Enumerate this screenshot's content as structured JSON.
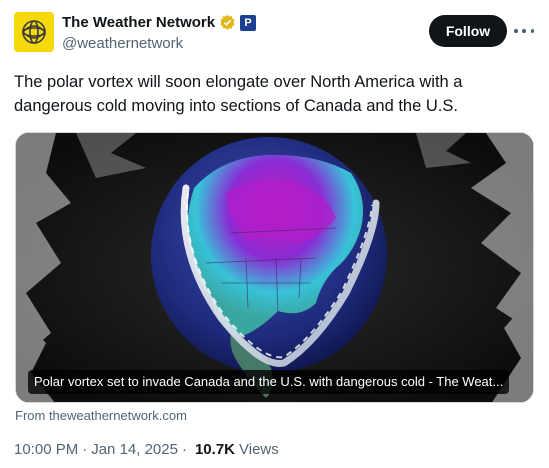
{
  "author": {
    "display_name": "The Weather Network",
    "handle": "@weathernetwork",
    "avatar_icon": "twn-globe-logo",
    "verified_icon": "gold-verified-check-icon",
    "affiliate_badge_icon": "p-affiliate-badge",
    "affiliate_badge_text": "P"
  },
  "actions": {
    "follow_label": "Follow",
    "more_icon": "more-horizontal-icon"
  },
  "tweet": {
    "text": "The polar vortex will soon elongate over North America with a dangerous cold moving into sections of Canada and the U.S."
  },
  "link_card": {
    "caption": "Polar vortex set to invade Canada and the U.S. with dangerous cold - The Weat...",
    "source": "From theweathernetwork.com"
  },
  "meta": {
    "time": "10:00 PM",
    "date": "Jan 14, 2025",
    "separator": "·",
    "views_count": "10.7K",
    "views_label": "Views"
  },
  "colors": {
    "text_primary": "#0f1419",
    "text_secondary": "#536471",
    "follow_bg": "#0f1419",
    "avatar_bg": "#f5d90a",
    "verified_gold": "#e2b719"
  }
}
